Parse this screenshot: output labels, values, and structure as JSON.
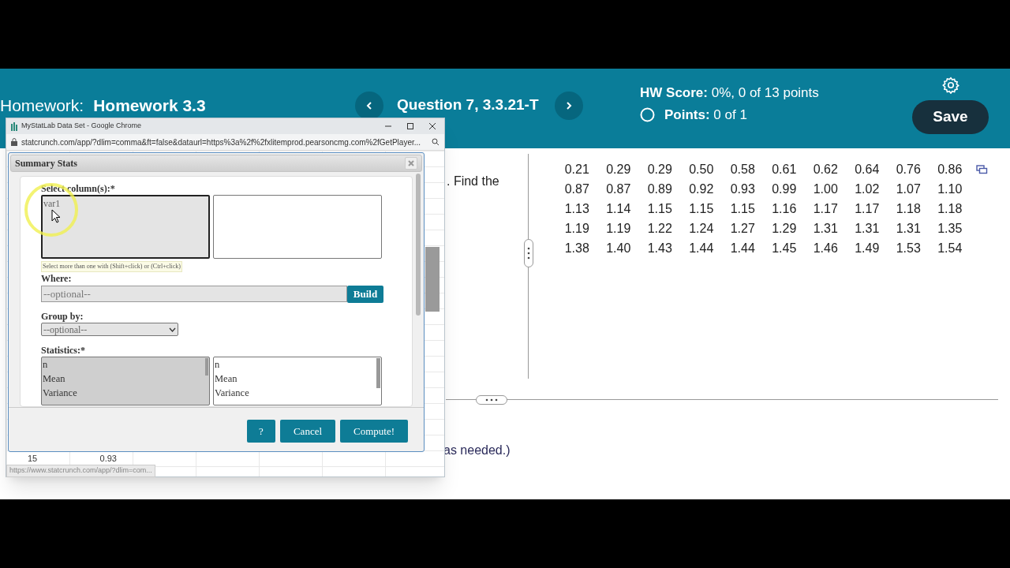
{
  "header": {
    "label": "Homework:",
    "title": "Homework 3.3",
    "question": "Question 7, 3.3.21-T",
    "hw_score_label": "HW Score:",
    "hw_score": "0%, 0 of 13 points",
    "points_label": "Points:",
    "points": "0 of 1",
    "save": "Save"
  },
  "question": {
    "text_fragment": ". Find the",
    "answer_fragment": "as needed.)",
    "data_rows": [
      [
        "0.21",
        "0.29",
        "0.29",
        "0.50",
        "0.58",
        "0.61",
        "0.62",
        "0.64",
        "0.76",
        "0.86"
      ],
      [
        "0.87",
        "0.87",
        "0.89",
        "0.92",
        "0.93",
        "0.99",
        "1.00",
        "1.02",
        "1.07",
        "1.10"
      ],
      [
        "1.13",
        "1.14",
        "1.15",
        "1.15",
        "1.15",
        "1.16",
        "1.17",
        "1.17",
        "1.18",
        "1.18"
      ],
      [
        "1.19",
        "1.19",
        "1.22",
        "1.24",
        "1.27",
        "1.29",
        "1.31",
        "1.31",
        "1.31",
        "1.35"
      ],
      [
        "1.38",
        "1.40",
        "1.43",
        "1.44",
        "1.44",
        "1.45",
        "1.46",
        "1.49",
        "1.53",
        "1.54"
      ]
    ]
  },
  "popup": {
    "title": "MyStatLab Data Set - Google Chrome",
    "url": "statcrunch.com/app/?dlim=comma&ft=false&dataurl=https%3a%2f%2fxlitemprod.pearsoncmg.com%2fGetPlayer...",
    "sheet_row": [
      "15",
      "0.93"
    ],
    "status_url": "https://www.statcrunch.com/app/?dlim=com...",
    "dialog": {
      "title": "Summary Stats",
      "select_label": "Select column(s):*",
      "columns": [
        {
          "name": "var1",
          "selected": false
        }
      ],
      "hint": "Select more than one with (Shift+click) or (Ctrl+click)",
      "where_label": "Where:",
      "where_placeholder": "--optional--",
      "build": "Build",
      "group_label": "Group by:",
      "group_value": "--optional--",
      "stats_label": "Statistics:*",
      "stats_available": [
        "n",
        "Mean",
        "Variance"
      ],
      "stats_selected": [
        "n",
        "Mean",
        "Variance"
      ],
      "buttons": [
        {
          "label": "?",
          "kind": "help"
        },
        {
          "label": "Cancel",
          "kind": "cancel"
        },
        {
          "label": "Compute!",
          "kind": "submit"
        }
      ]
    }
  }
}
